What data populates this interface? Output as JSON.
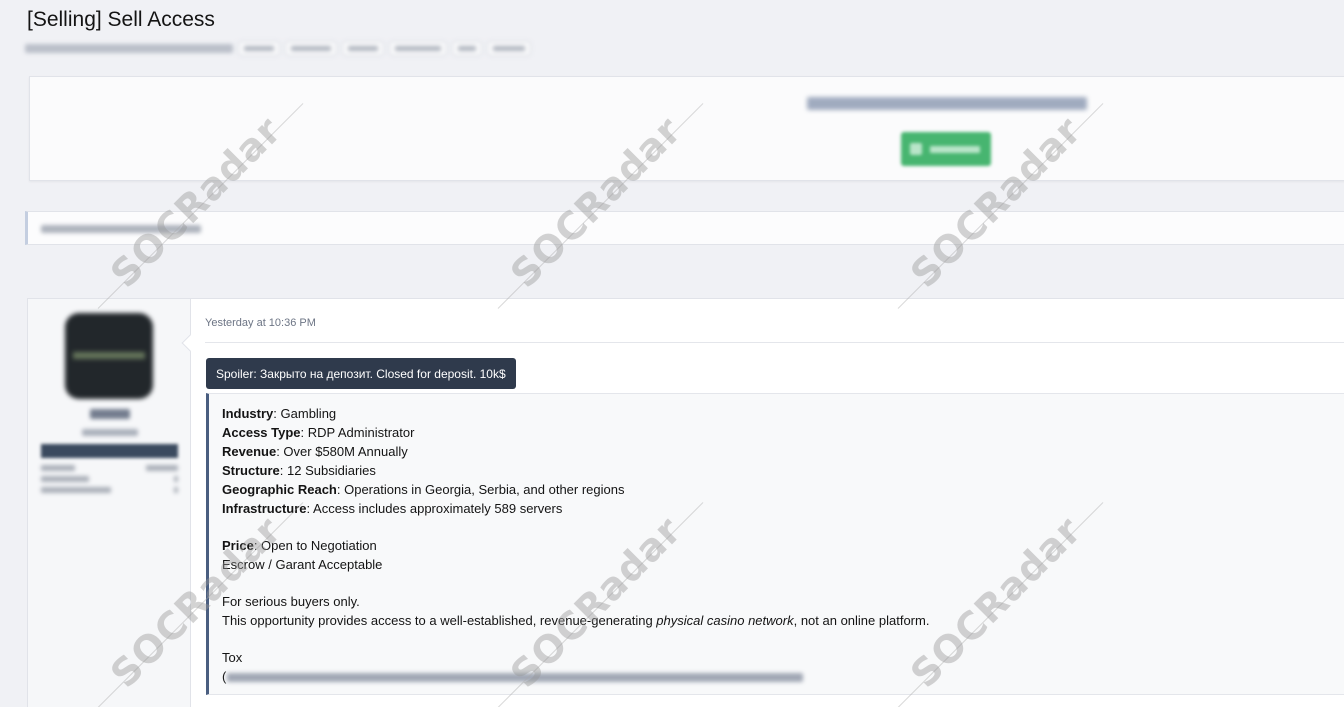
{
  "thread": {
    "title": "[Selling] Sell Access"
  },
  "post": {
    "date": "Yesterday at 10:36 PM",
    "spoiler_label": "Spoiler: Закрыто на депозит. Closed for deposit. 10k$",
    "details": [
      {
        "label": "Industry",
        "value": ": Gambling"
      },
      {
        "label": "Access Type",
        "value": ": RDP Administrator"
      },
      {
        "label": "Revenue",
        "value": ": Over $580M Annually"
      },
      {
        "label": "Structure",
        "value": ": 12 Subsidiaries"
      },
      {
        "label": "Geographic Reach",
        "value": ": Operations in Georgia, Serbia, and other regions"
      },
      {
        "label": "Infrastructure",
        "value": ": Access includes approximately 589 servers"
      }
    ],
    "price_label": "Price",
    "price_value": ": Open to Negotiation",
    "escrow": "Escrow / Garant Acceptable",
    "serious": "For serious buyers only.",
    "opportunity_pre": "This opportunity provides access to a well-established, revenue-generating ",
    "opportunity_em": "physical casino network",
    "opportunity_post": ", not an online platform.",
    "contact_label": "Tox",
    "contact_prefix": "("
  },
  "watermark": {
    "text": "SOCRadar"
  }
}
